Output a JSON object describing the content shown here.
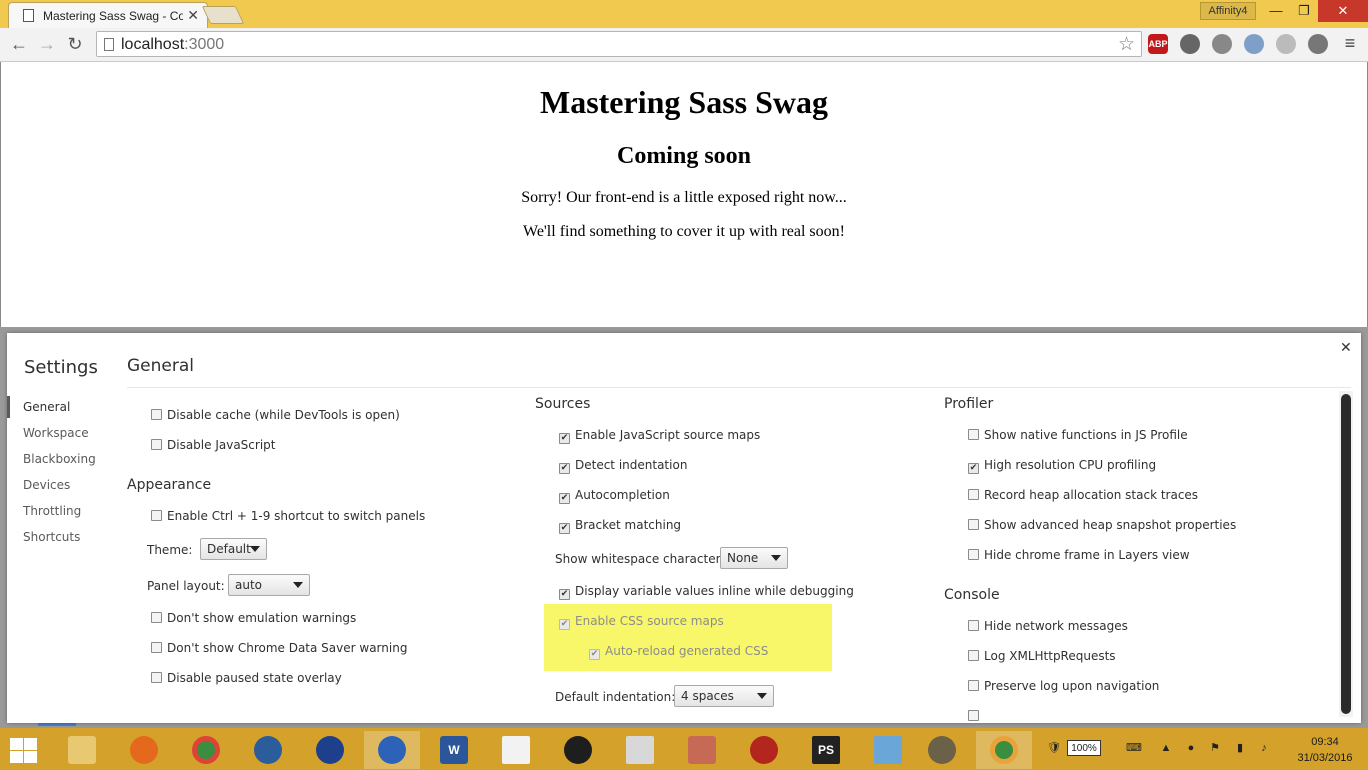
{
  "browser": {
    "tab_title": "Mastering Sass Swag - Co",
    "profile_name": "Affinity4",
    "url_host": "localhost",
    "url_port": ":3000",
    "ext_abp": "ABP"
  },
  "page": {
    "title": "Mastering Sass Swag",
    "subtitle": "Coming soon",
    "line1": "Sorry! Our front-end is a little exposed right now...",
    "line2": "We'll find something to cover it up with real soon!"
  },
  "settings": {
    "title": "Settings",
    "section_title": "General",
    "sidebar": [
      "General",
      "Workspace",
      "Blackboxing",
      "Devices",
      "Throttling",
      "Shortcuts"
    ],
    "general": {
      "disable_cache": "Disable cache (while DevTools is open)",
      "disable_js": "Disable JavaScript"
    },
    "appearance": {
      "heading": "Appearance",
      "ctrl_shortcut": "Enable Ctrl + 1-9 shortcut to switch panels",
      "theme_label": "Theme:",
      "theme_value": "Default",
      "layout_label": "Panel layout:",
      "layout_value": "auto",
      "no_emulation_warn": "Don't show emulation warnings",
      "no_datasaver_warn": "Don't show Chrome Data Saver warning",
      "disable_paused_overlay": "Disable paused state overlay"
    },
    "sources": {
      "heading": "Sources",
      "js_source_maps": "Enable JavaScript source maps",
      "detect_indentation": "Detect indentation",
      "autocompletion": "Autocompletion",
      "bracket_matching": "Bracket matching",
      "whitespace_label": "Show whitespace characters:",
      "whitespace_value": "None",
      "inline_values": "Display variable values inline while debugging",
      "css_source_maps": "Enable CSS source maps",
      "auto_reload_css": "Auto-reload generated CSS",
      "indent_label": "Default indentation:",
      "indent_value": "4 spaces"
    },
    "profiler": {
      "heading": "Profiler",
      "native_functions": "Show native functions in JS Profile",
      "high_res_cpu": "High resolution CPU profiling",
      "heap_alloc": "Record heap allocation stack traces",
      "heap_snapshot": "Show advanced heap snapshot properties",
      "hide_chrome_frame": "Hide chrome frame in Layers view"
    },
    "console": {
      "heading": "Console",
      "hide_network": "Hide network messages",
      "log_xhr": "Log XMLHttpRequests",
      "preserve_log": "Preserve log upon navigation"
    }
  },
  "taskbar": {
    "battery": "100%",
    "time": "09:34",
    "date": "31/03/2016",
    "word_label": "W",
    "ps_label": "PS"
  },
  "colors": {
    "titlebar": "#f0c94e",
    "taskbar": "#d4a22a",
    "highlight": "#f8f76a"
  }
}
